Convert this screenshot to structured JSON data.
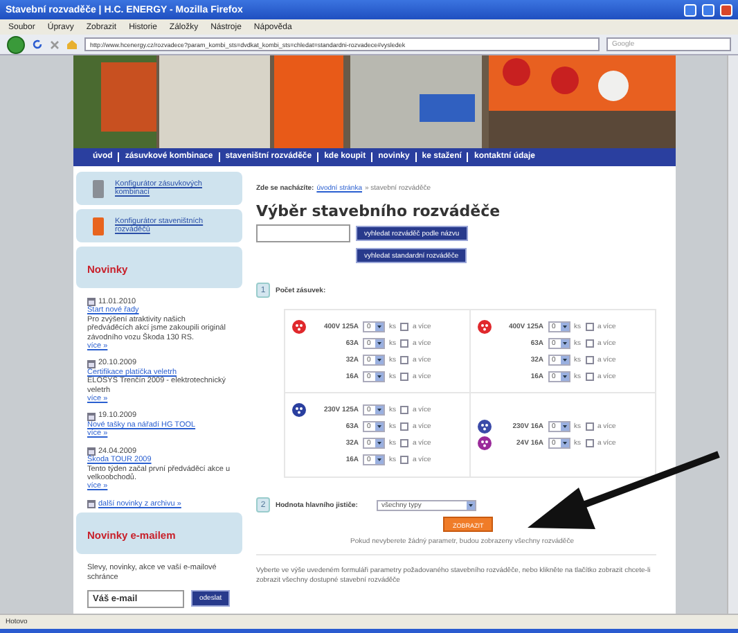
{
  "window": {
    "title": "Stavební rozvaděče | H.C. ENERGY - Mozilla Firefox"
  },
  "menu": [
    "Soubor",
    "Úpravy",
    "Zobrazit",
    "Historie",
    "Záložky",
    "Nástroje",
    "Nápověda"
  ],
  "address_bar": {
    "value": "http://www.hcenergy.cz/rozvadece?param_kombi_sts=dvdkat_kombi_sts=chledat=standardni-rozvadece#vysledek"
  },
  "search_box": {
    "placeholder": "Google"
  },
  "nav": [
    "úvod",
    "zásuvkové kombinace",
    "staveništní rozváděče",
    "kde koupit",
    "novinky",
    "ke stažení",
    "kontaktní údaje"
  ],
  "sidebar": {
    "configurators": [
      {
        "label": "Konfigurátor zásuvkových kombinací",
        "color": "#8a8f96"
      },
      {
        "label": "Konfigurátor staveništních rozváděčů",
        "color": "#e8641e"
      }
    ],
    "news_title": "Novinky",
    "news": [
      {
        "date": "11.01.2010",
        "title": "Start nové řady",
        "text": "Pro zvýšení atraktivity našich předváděcích akcí jsme zakoupili originál závodního vozu Škoda 130 RS.",
        "more": "více »"
      },
      {
        "date": "20.10.2009",
        "title": "Certifikace platíčka veletrh",
        "text": "ELOSYS Trenčín 2009 - elektrotechnický veletrh",
        "more": "více »"
      },
      {
        "date": "19.10.2009",
        "title": "Nové tašky na nářadí HG TOOL",
        "more": "více »"
      },
      {
        "date": "24.04.2009",
        "title": "Škoda TOUR 2009",
        "text": "Tento týden začal první předváděcí akce u velkoobchodů.",
        "more": "více »"
      }
    ],
    "archive_link": "další novinky z archivu »",
    "newsletter": {
      "title": "Novinky e-mailem",
      "text": "Slevy, novinky, akce ve vaší e-mailové schránce",
      "value": "Váš e-mail",
      "button": "odeslat"
    }
  },
  "main": {
    "breadcrumb": {
      "label": "Zde se nacházíte:",
      "link": "úvodní stránka",
      "current": "» stavební rozváděče"
    },
    "heading": "Výběr stavebního rozváděče",
    "search_buttons": [
      "vyhledat rozváděč podle názvu",
      "vyhledat standardní rozváděče"
    ],
    "step1": {
      "number": "1",
      "label": "Počet zásuvek:"
    },
    "socket_groups": [
      {
        "rows": [
          {
            "label": "400V 125A",
            "color": "#e0282c",
            "count": "0",
            "unit": "ks",
            "more": "a více",
            "checked": false
          },
          {
            "label": "63A",
            "count": "0",
            "unit": "ks",
            "more": "a více",
            "checked": false
          },
          {
            "label": "32A",
            "count": "0",
            "unit": "ks",
            "more": "a více",
            "checked": false
          },
          {
            "label": "16A",
            "count": "0",
            "unit": "ks",
            "more": "a více",
            "checked": false
          }
        ]
      },
      {
        "rows": [
          {
            "label": "400V 125A",
            "color": "#e0282c",
            "count": "0",
            "unit": "ks",
            "more": "a více",
            "checked": false
          },
          {
            "label": "63A",
            "count": "0",
            "unit": "ks",
            "more": "a více",
            "checked": false
          },
          {
            "label": "32A",
            "count": "0",
            "unit": "ks",
            "more": "a více",
            "checked": false
          },
          {
            "label": "16A",
            "count": "0",
            "unit": "ks",
            "more": "a více",
            "checked": false
          }
        ]
      },
      {
        "rows": [
          {
            "label": "230V 125A",
            "color": "#2a3f9f",
            "count": "0",
            "unit": "ks",
            "more": "a více",
            "checked": false
          },
          {
            "label": "63A",
            "count": "0",
            "unit": "ks",
            "more": "a více",
            "checked": false
          },
          {
            "label": "32A",
            "count": "0",
            "unit": "ks",
            "more": "a více",
            "checked": false
          },
          {
            "label": "16A",
            "count": "0",
            "unit": "ks",
            "more": "a více",
            "checked": false
          }
        ]
      },
      {
        "rows": [
          {
            "label": "230V 16A",
            "color": "#3a4aa8",
            "count": "0",
            "unit": "ks",
            "more": "a více",
            "checked": false
          },
          {
            "label": "24V 16A",
            "color": "#9a2a9a",
            "count": "0",
            "unit": "ks",
            "more": "a více",
            "checked": false
          }
        ]
      }
    ],
    "step2": {
      "number": "2",
      "label": "Hodnota hlavního jističe:",
      "select": "všechny typy"
    },
    "show_button": "ZOBRAZIT",
    "note": "Pokud nevyberete žádný parametr, budou zobrazeny všechny rozváděče",
    "description": "Vyberte ve výše uvedeném formuláři parametry požadovaného stavebního rozváděče, nebo klikněte na tlačítko zobrazit chcete-li zobrazit všechny dostupné stavební rozváděče"
  },
  "status_bar": "Hotovo"
}
